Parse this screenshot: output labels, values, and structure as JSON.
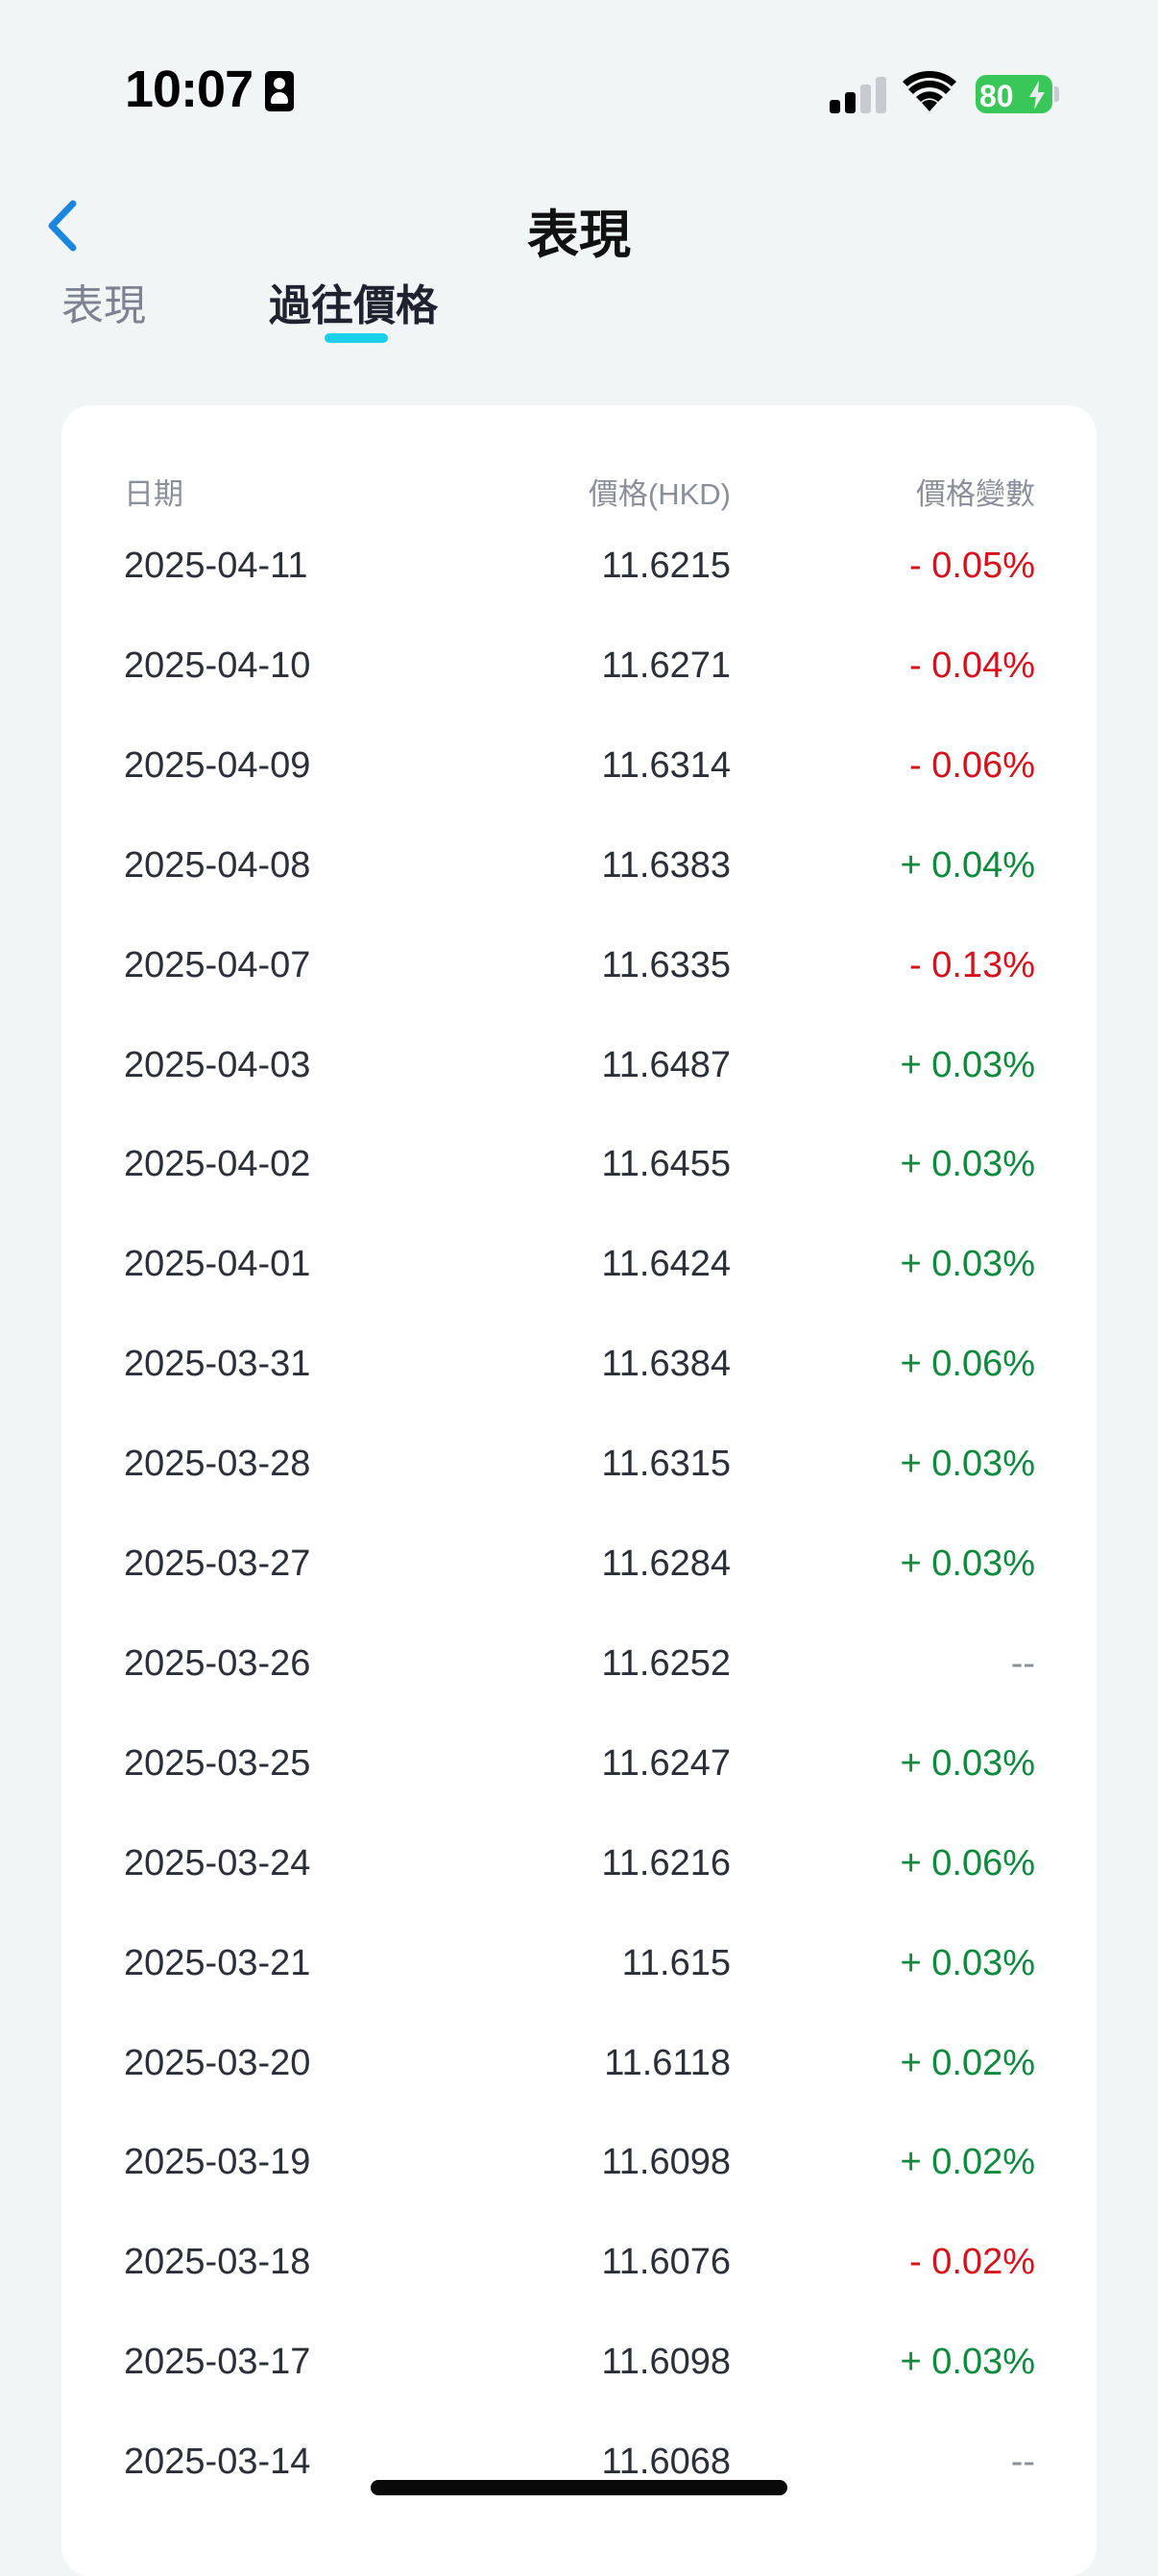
{
  "status_bar": {
    "time": "10:07",
    "battery": "80"
  },
  "nav": {
    "title": "表現"
  },
  "tabs": [
    {
      "label": "表現"
    },
    {
      "label": "過往價格"
    }
  ],
  "table": {
    "headers": {
      "date": "日期",
      "price": "價格(HKD)",
      "change": "價格變數"
    },
    "rows": [
      {
        "date": "2025-04-11",
        "price": "11.6215",
        "change": "- 0.05%",
        "dir": "neg"
      },
      {
        "date": "2025-04-10",
        "price": "11.6271",
        "change": "- 0.04%",
        "dir": "neg"
      },
      {
        "date": "2025-04-09",
        "price": "11.6314",
        "change": "- 0.06%",
        "dir": "neg"
      },
      {
        "date": "2025-04-08",
        "price": "11.6383",
        "change": "+ 0.04%",
        "dir": "pos"
      },
      {
        "date": "2025-04-07",
        "price": "11.6335",
        "change": "- 0.13%",
        "dir": "neg"
      },
      {
        "date": "2025-04-03",
        "price": "11.6487",
        "change": "+ 0.03%",
        "dir": "pos"
      },
      {
        "date": "2025-04-02",
        "price": "11.6455",
        "change": "+ 0.03%",
        "dir": "pos"
      },
      {
        "date": "2025-04-01",
        "price": "11.6424",
        "change": "+ 0.03%",
        "dir": "pos"
      },
      {
        "date": "2025-03-31",
        "price": "11.6384",
        "change": "+ 0.06%",
        "dir": "pos"
      },
      {
        "date": "2025-03-28",
        "price": "11.6315",
        "change": "+ 0.03%",
        "dir": "pos"
      },
      {
        "date": "2025-03-27",
        "price": "11.6284",
        "change": "+ 0.03%",
        "dir": "pos"
      },
      {
        "date": "2025-03-26",
        "price": "11.6252",
        "change": "--",
        "dir": "flat"
      },
      {
        "date": "2025-03-25",
        "price": "11.6247",
        "change": "+ 0.03%",
        "dir": "pos"
      },
      {
        "date": "2025-03-24",
        "price": "11.6216",
        "change": "+ 0.06%",
        "dir": "pos"
      },
      {
        "date": "2025-03-21",
        "price": "11.615",
        "change": "+ 0.03%",
        "dir": "pos"
      },
      {
        "date": "2025-03-20",
        "price": "11.6118",
        "change": "+ 0.02%",
        "dir": "pos"
      },
      {
        "date": "2025-03-19",
        "price": "11.6098",
        "change": "+ 0.02%",
        "dir": "pos"
      },
      {
        "date": "2025-03-18",
        "price": "11.6076",
        "change": "- 0.02%",
        "dir": "neg"
      },
      {
        "date": "2025-03-17",
        "price": "11.6098",
        "change": "+ 0.03%",
        "dir": "pos"
      },
      {
        "date": "2025-03-14",
        "price": "11.6068",
        "change": "--",
        "dir": "flat"
      }
    ]
  },
  "colors": {
    "negative": "#d4121b",
    "positive": "#0e8a3c",
    "tab_indicator": "#1ad0e8",
    "back_arrow": "#1a86e0"
  }
}
